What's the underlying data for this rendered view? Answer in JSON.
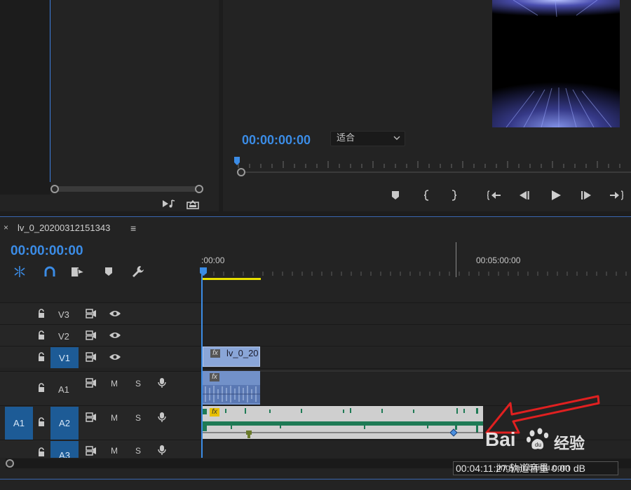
{
  "program": {
    "timecode": "00:00:00:00",
    "fit_label": "适合"
  },
  "sequence": {
    "tab_close": "×",
    "name": "lv_0_20200312151343",
    "menu_icon": "≡",
    "timecode": "00:00:00:00",
    "ruler_labels": [
      ":00:00",
      "00:05:00:00"
    ]
  },
  "tracks": {
    "video": [
      {
        "name": "V3"
      },
      {
        "name": "V2"
      },
      {
        "name": "V1"
      }
    ],
    "audio": [
      {
        "name": "A1",
        "mute": "M",
        "solo": "S"
      },
      {
        "name": "A2",
        "mute": "M",
        "solo": "S",
        "source": "A1"
      },
      {
        "name": "A3",
        "mute": "M",
        "solo": "S"
      }
    ]
  },
  "clips": {
    "video_clip_label": "lv_0_20",
    "fx_badge": "fx"
  },
  "status": {
    "tooltip": "00:04:11:27 轨道音量 0.00 dB"
  },
  "watermark": {
    "brand": "Bai",
    "brand_suffix": "经验",
    "site": "jingyan.baidu.com"
  },
  "colors": {
    "accent_blue": "#3b8ce6",
    "video_clip": "#8aa6d8",
    "audio_clip": "#7291c9",
    "audio_a2_bg": "#cfcfcf",
    "audio_wave": "#1e7a55",
    "work_area": "#e8e000",
    "annotation_arrow": "#e02020"
  },
  "icons": {
    "source": [
      "insert-audio-icon",
      "export-frame-icon"
    ],
    "transport": [
      "add-marker-icon",
      "mark-in-icon",
      "mark-out-icon",
      "go-to-in-icon",
      "step-back-icon",
      "play-icon",
      "step-forward-icon",
      "go-to-out-icon"
    ],
    "tools": [
      "snap-icon",
      "linked-selection-icon",
      "add-edit-icon",
      "marker-icon",
      "wrench-icon"
    ],
    "track_header": [
      "lock-icon",
      "film-toggle-icon",
      "eye-icon",
      "microphone-icon"
    ]
  }
}
